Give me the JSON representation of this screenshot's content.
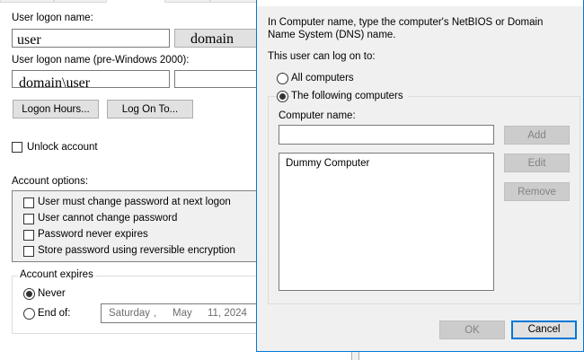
{
  "left": {
    "logon_name_label": "User logon name:",
    "logon_name_value": "user",
    "domain_value": "domain",
    "pre2000_label": "User logon name (pre-Windows 2000):",
    "pre2000_value": "domain\\user",
    "logon_hours_button": "Logon Hours...",
    "log_on_to_button": "Log On To...",
    "unlock_account": "Unlock account",
    "account_options_label": "Account options:",
    "account_options": [
      "User must change password at next logon",
      "User cannot change password",
      "Password never expires",
      "Store password using reversible encryption"
    ],
    "account_expires_label": "Account expires",
    "never_label": "Never",
    "end_of_label": "End of:",
    "date": {
      "weekday": "Saturday",
      "sep": ",",
      "month": "May",
      "day_year": "11, 2024"
    }
  },
  "dialog": {
    "instructions": "In Computer name, type the computer's NetBIOS or Domain Name System (DNS) name.",
    "can_log_on_label": "This user can log on to:",
    "all_computers": "All computers",
    "following_computers": "The following computers",
    "computer_name_label": "Computer name:",
    "computer_name_value": "",
    "computers": [
      "Dummy Computer"
    ],
    "add_button": "Add",
    "edit_button": "Edit",
    "remove_button": "Remove",
    "ok_button": "OK",
    "cancel_button": "Cancel",
    "accent_color": "#0078d7"
  }
}
